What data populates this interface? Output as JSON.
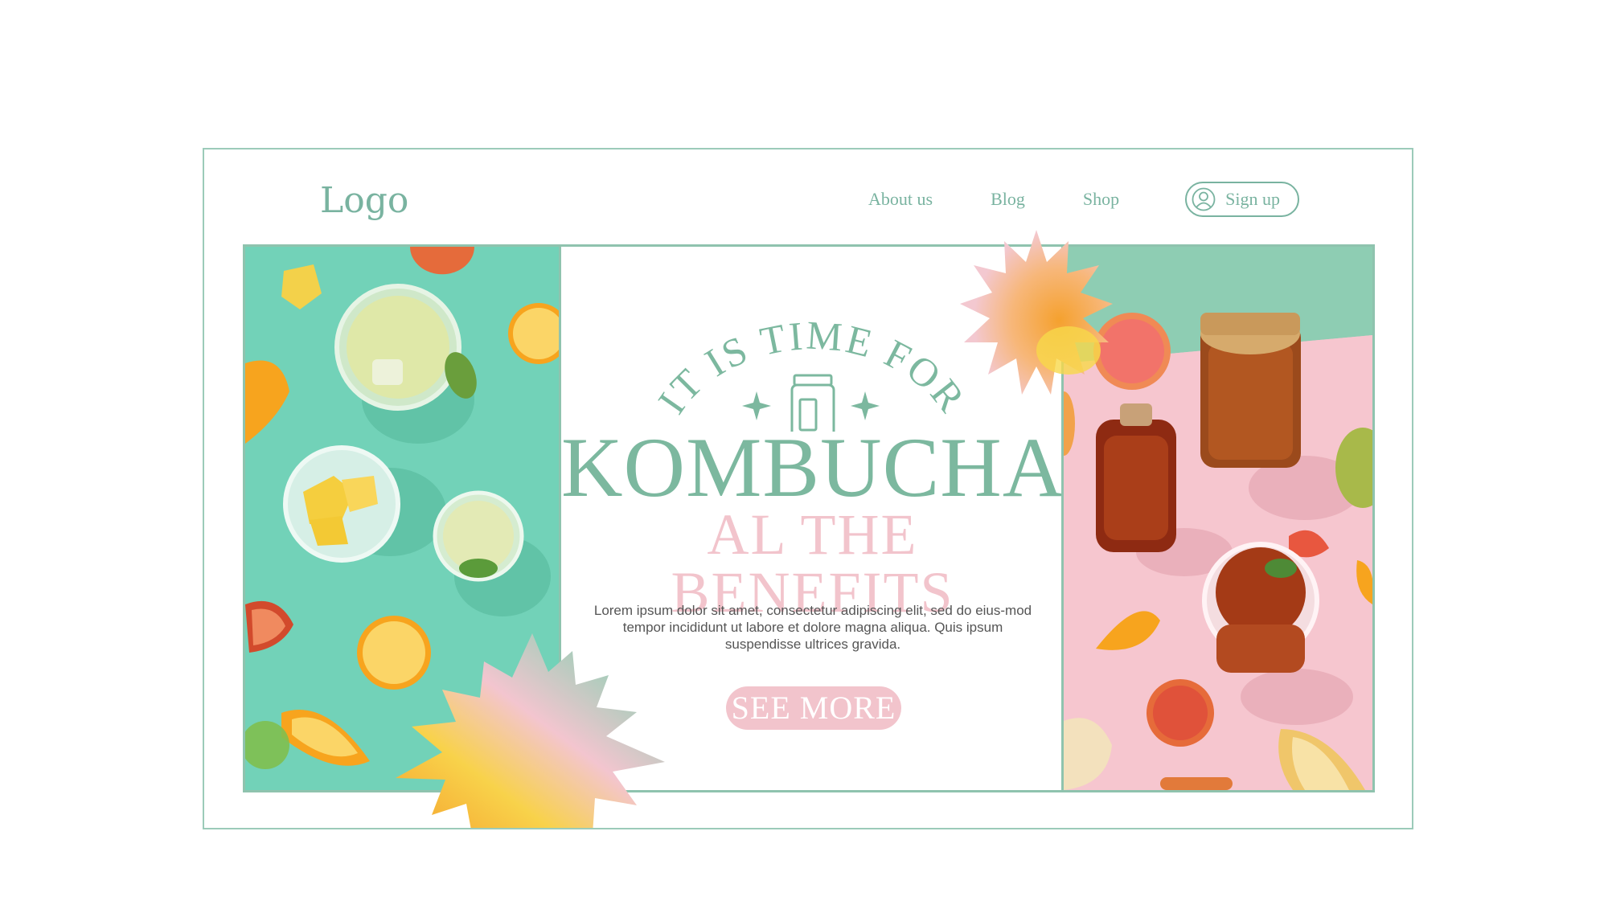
{
  "header": {
    "logo": "Logo",
    "nav": [
      "About us",
      "Blog",
      "Shop"
    ],
    "signup_label": "Sign up"
  },
  "hero": {
    "arc_text": "IT IS TIME FOR",
    "title": "KOMBUCHA",
    "subtitle": "AL THE BENEFITS",
    "body": "Lorem ipsum dolor sit amet, consectetur adipiscing elit, sed do eius-mod tempor incididunt ut labore et dolore magna aliqua. Quis ipsum suspendisse ultrices gravida.",
    "cta_label": "SEE MORE"
  },
  "colors": {
    "mint": "#79b3a0",
    "pink": "#f2c4cc",
    "teal_bg": "#74d3b9",
    "orange": "#f5a336",
    "yellow": "#f9d24a"
  },
  "icons": {
    "user": "user-circle-icon",
    "jar": "jar-icon",
    "sparkle": "sparkle-icon"
  }
}
